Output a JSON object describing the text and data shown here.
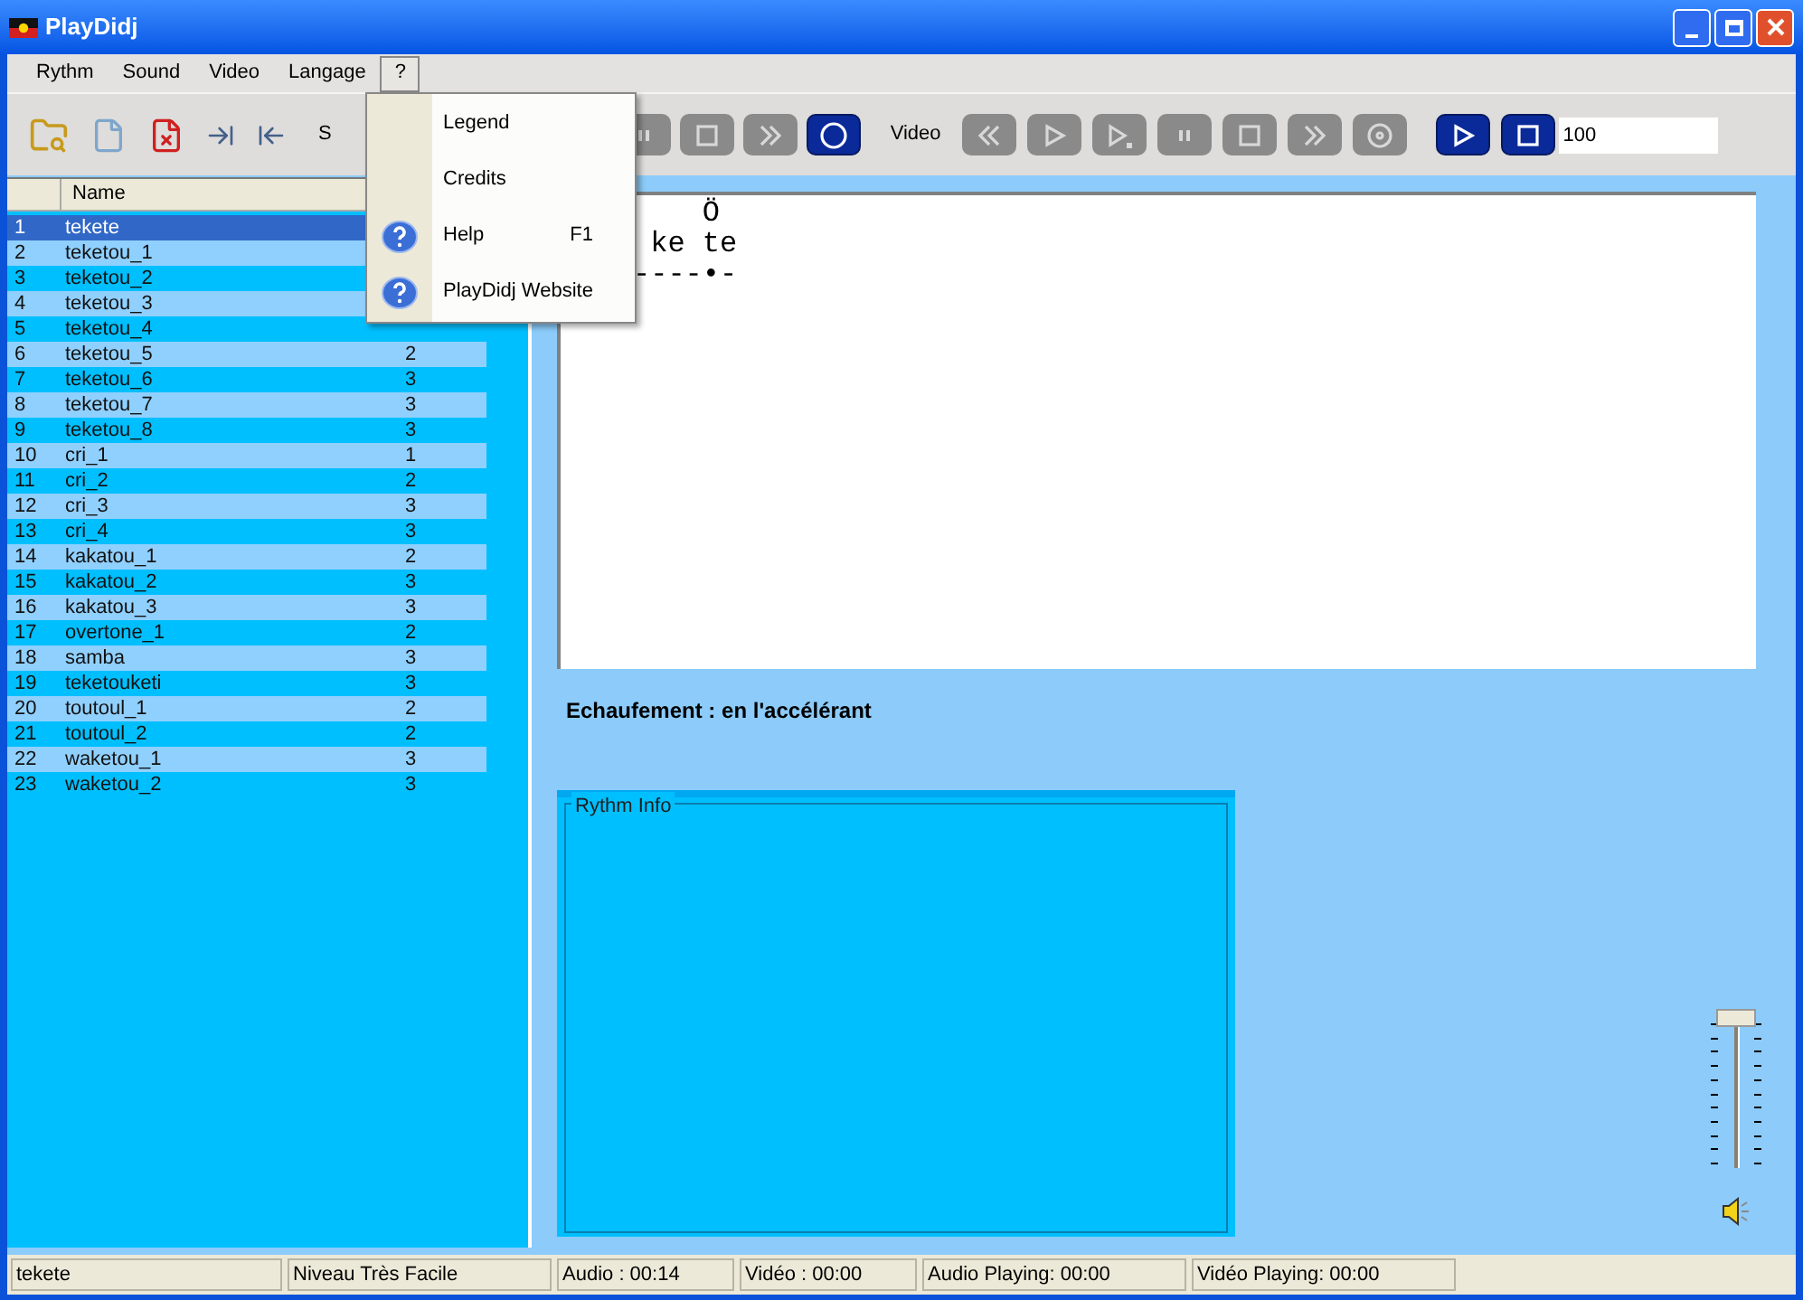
{
  "window": {
    "title": "PlayDidj"
  },
  "menu_bar": [
    {
      "label": "Rythm",
      "selected": false
    },
    {
      "label": "Sound",
      "selected": false
    },
    {
      "label": "Video",
      "selected": false
    },
    {
      "label": "Langage",
      "selected": false
    },
    {
      "label": "?",
      "selected": true
    }
  ],
  "help_menu": [
    {
      "label": "Legend",
      "kind": "plain"
    },
    {
      "label": "Credits",
      "kind": "plain"
    },
    {
      "label": "Help",
      "kind": "help",
      "shortcut": "F1"
    },
    {
      "label": "PlayDidj Website",
      "kind": "help"
    }
  ],
  "toolbar": {
    "sound_label": "S",
    "sound_buttons": [
      {
        "kind": "pause",
        "disabled": true
      },
      {
        "kind": "stop",
        "disabled": true
      },
      {
        "kind": "forward",
        "disabled": true
      },
      {
        "kind": "record",
        "disabled": false
      }
    ],
    "video_label": "Video",
    "video_buttons": [
      {
        "kind": "rewind",
        "disabled": true
      },
      {
        "kind": "play",
        "disabled": true
      },
      {
        "kind": "step",
        "disabled": true
      },
      {
        "kind": "pause",
        "disabled": true
      },
      {
        "kind": "stop",
        "disabled": true
      },
      {
        "kind": "forward",
        "disabled": true
      },
      {
        "kind": "disc",
        "disabled": true
      }
    ],
    "player_buttons": [
      {
        "kind": "play",
        "disabled": false
      },
      {
        "kind": "stop",
        "disabled": false
      }
    ],
    "tempo_value": "100"
  },
  "rythm_list": {
    "columns": [
      "Name"
    ],
    "rows": [
      {
        "number": "1",
        "name": "tekete",
        "selected": true
      },
      {
        "number": "2",
        "name": "teketou_1",
        "selected": false
      },
      {
        "number": "3",
        "name": "teketou_2",
        "selected": false
      },
      {
        "number": "4",
        "name": "teketou_3",
        "selected": false
      },
      {
        "number": "5",
        "name": "teketou_4",
        "selected": false
      },
      {
        "number": "6",
        "name": "teketou_5",
        "column_3": "2",
        "selected": false
      },
      {
        "number": "7",
        "name": "teketou_6",
        "column_3": "3",
        "selected": false
      },
      {
        "number": "8",
        "name": "teketou_7",
        "column_3": "3",
        "selected": false
      },
      {
        "number": "9",
        "name": "teketou_8",
        "column_3": "3",
        "selected": false
      },
      {
        "number": "10",
        "name": "cri_1",
        "column_3": "1",
        "selected": false
      },
      {
        "number": "11",
        "name": "cri_2",
        "column_3": "2",
        "selected": false
      },
      {
        "number": "12",
        "name": "cri_3",
        "column_3": "3",
        "selected": false
      },
      {
        "number": "13",
        "name": "cri_4",
        "column_3": "3",
        "selected": false
      },
      {
        "number": "14",
        "name": "kakatou_1",
        "column_3": "2",
        "selected": false
      },
      {
        "number": "15",
        "name": "kakatou_2",
        "column_3": "3",
        "selected": false
      },
      {
        "number": "16",
        "name": "kakatou_3",
        "column_3": "3",
        "selected": false
      },
      {
        "number": "17",
        "name": "overtone_1",
        "column_3": "2",
        "selected": false
      },
      {
        "number": "18",
        "name": "samba",
        "column_3": "3",
        "selected": false
      },
      {
        "number": "19",
        "name": "teketouketi",
        "column_3": "3",
        "selected": false
      },
      {
        "number": "20",
        "name": "toutoul_1",
        "column_3": "2",
        "selected": false
      },
      {
        "number": "21",
        "name": "toutoul_2",
        "column_3": "2",
        "selected": false
      },
      {
        "number": "22",
        "name": "waketou_1",
        "column_3": "3",
        "selected": false
      },
      {
        "number": "23",
        "name": "waketou_2",
        "column_3": "3",
        "selected": false
      }
    ]
  },
  "notation": {
    "lines": [
      "    Ö",
      " ke te",
      "----•-"
    ]
  },
  "description": "Echaufement : en l'accélérant",
  "rythm_info": {
    "title": "Rythm Info"
  },
  "volume": {
    "level": 1
  },
  "status_bar": [
    "tekete",
    "Niveau Très Facile",
    "Audio : 00:14",
    "Vidéo : 00:00",
    "Audio Playing: 00:00",
    "Vidéo Playing: 00:00"
  ]
}
